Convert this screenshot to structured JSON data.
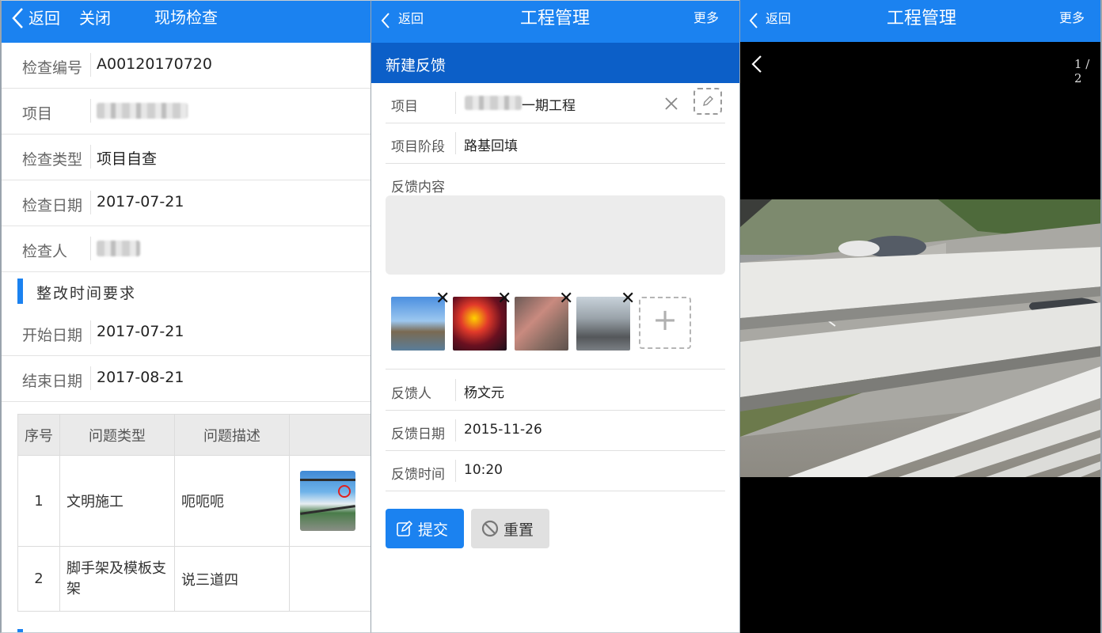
{
  "panel1": {
    "header": {
      "back": "返回",
      "close": "关闭",
      "title": "现场检查"
    },
    "fields": [
      {
        "label": "检查编号",
        "value": "A00120170720"
      },
      {
        "label": "项目",
        "value": ""
      },
      {
        "label": "检查类型",
        "value": "项目自查"
      },
      {
        "label": "检查日期",
        "value": "2017-07-21"
      },
      {
        "label": "检查人",
        "value": ""
      }
    ],
    "section_title": "整改时间要求",
    "dates": [
      {
        "label": "开始日期",
        "value": "2017-07-21"
      },
      {
        "label": "结束日期",
        "value": "2017-08-21"
      }
    ],
    "table": {
      "headers": [
        "序号",
        "问题类型",
        "问题描述",
        ""
      ],
      "rows": [
        {
          "no": "1",
          "type": "文明施工",
          "desc": "呃呃呃"
        },
        {
          "no": "2",
          "type": "脚手架及模板支架",
          "desc": "说三道四"
        }
      ]
    }
  },
  "panel2": {
    "header": {
      "back": "返回",
      "title": "工程管理",
      "more": "更多"
    },
    "subheader": "新建反馈",
    "project": {
      "label": "项目",
      "value": "一期工程"
    },
    "stage": {
      "label": "项目阶段",
      "value": "路基回填"
    },
    "content_label": "反馈内容",
    "content_value": "",
    "photo_remove_glyph": "✕",
    "add_glyph": "+",
    "feedback_person": {
      "label": "反馈人",
      "value": "杨文元"
    },
    "feedback_date": {
      "label": "反馈日期",
      "value": "2015-11-26"
    },
    "feedback_time": {
      "label": "反馈时间",
      "value": "10:20"
    },
    "submit": "提交",
    "reset": "重置",
    "colors": {
      "primary": "#1b82f0",
      "subheader": "#0c5fc8"
    }
  },
  "panel3": {
    "header": {
      "back": "返回",
      "title": "工程管理",
      "more": "更多"
    },
    "counter": "1 / 2"
  }
}
